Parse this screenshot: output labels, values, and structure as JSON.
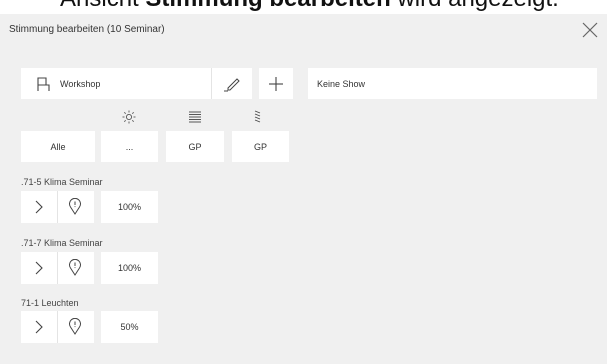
{
  "background_title": {
    "prefix": "Ansicht ",
    "bold": "Stimmung bearbeiten",
    "suffix": " wird angezeigt."
  },
  "dialog": {
    "title": "Stimmung bearbeiten (10 Seminar)",
    "close_icon": "close-x-icon"
  },
  "toolbar": {
    "scene_icon": "chair-icon",
    "scene_name": "Workshop",
    "edit_icon": "pencil-icon",
    "add_icon": "plus-icon",
    "show_value": "Keine Show"
  },
  "filter_icons": [
    "sun-icon",
    "blinds-horizontal-icon",
    "blinds-slanted-icon"
  ],
  "filters": [
    "Alle",
    "...",
    "GP",
    "GP"
  ],
  "groups": [
    {
      "title": ".71-5 Klima Seminar",
      "value": "100%"
    },
    {
      "title": ".71-7 Klima Seminar",
      "value": "100%"
    },
    {
      "title": "71-1 Leuchten",
      "value": "50%"
    }
  ],
  "colors": {
    "panel": "#f0f0f0",
    "tile": "#ffffff",
    "text": "#333333"
  }
}
